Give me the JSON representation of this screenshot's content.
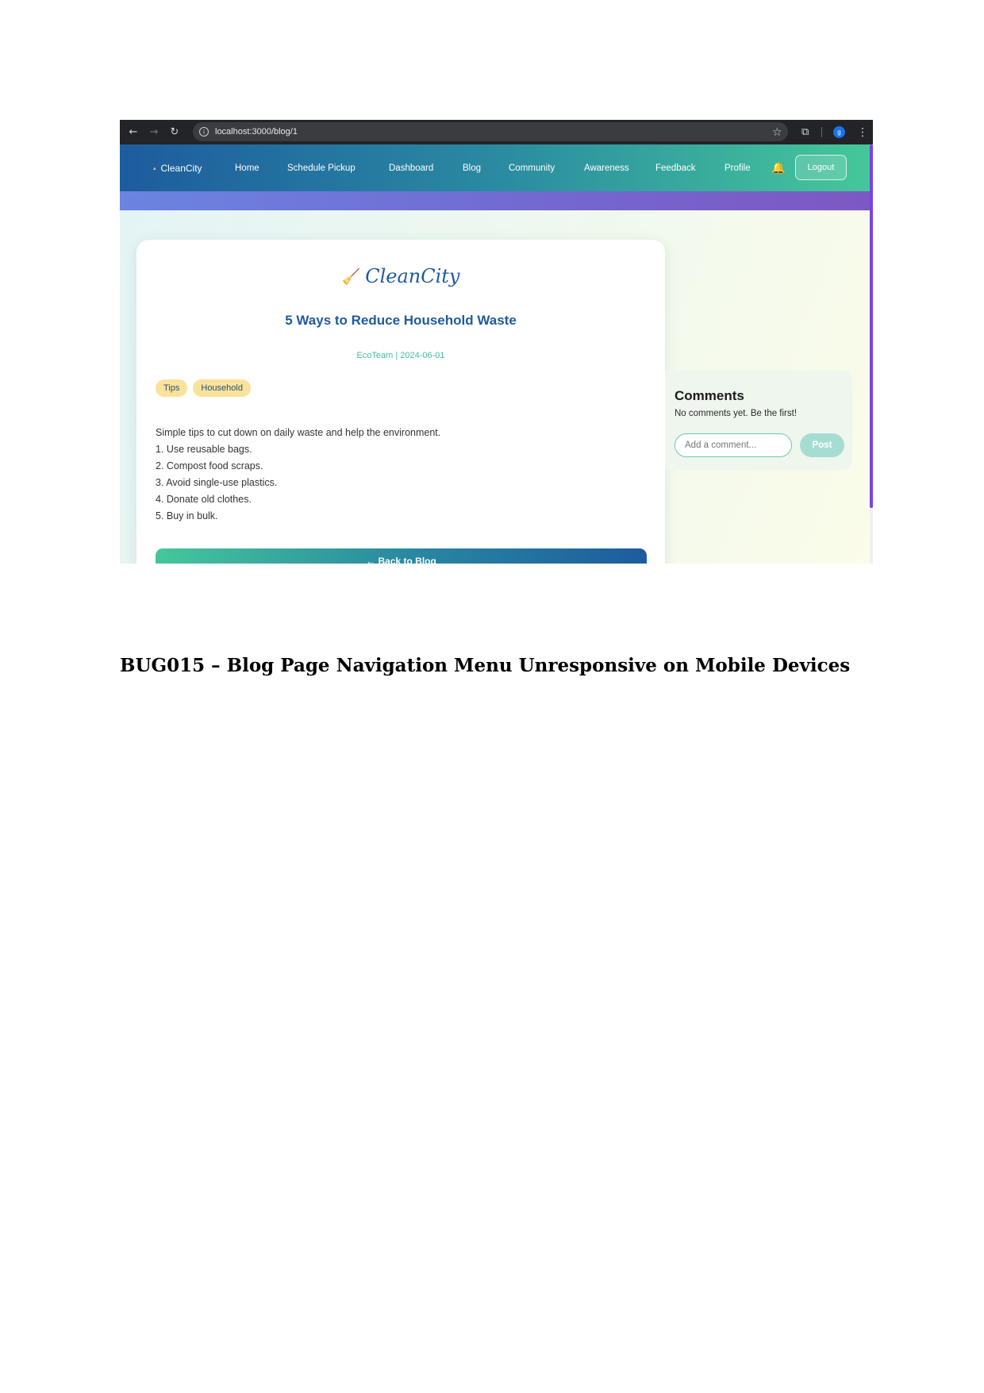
{
  "browser": {
    "url": "localhost:3000/blog/1",
    "back_icon": "←",
    "forward_icon": "→",
    "reload_icon": "↻",
    "info_icon": "i",
    "star_icon": "☆",
    "extensions_icon": "⧉",
    "profile_initial": "g",
    "menu_icon": "⋮"
  },
  "navbar": {
    "brand_icon": "▴",
    "brand": "CleanCity",
    "links": [
      "Home",
      "Schedule Pickup",
      "Dashboard",
      "Blog",
      "Community",
      "Awareness",
      "Feedback",
      "Profile"
    ],
    "bell_icon": "🔔",
    "logout": "Logout"
  },
  "article": {
    "logo_icon": "🧹",
    "logo_text": "CleanCity",
    "title": "5 Ways to Reduce Household Waste",
    "meta": "EcoTeam | 2024-06-01",
    "tags": [
      "Tips",
      "Household"
    ],
    "body_lines": [
      "Simple tips to cut down on daily waste and help the environment.",
      "1. Use reusable bags.",
      "2. Compost food scraps.",
      "3. Avoid single-use plastics.",
      "4. Donate old clothes.",
      "5. Buy in bulk."
    ],
    "back_button": "← Back to Blog"
  },
  "comments": {
    "heading": "Comments",
    "empty_text": "No comments yet. Be the first!",
    "input_placeholder": "Add a comment...",
    "post_button": "Post"
  },
  "caption": "BUG015 – Blog Page Navigation Menu Unresponsive on Mobile Devices"
}
